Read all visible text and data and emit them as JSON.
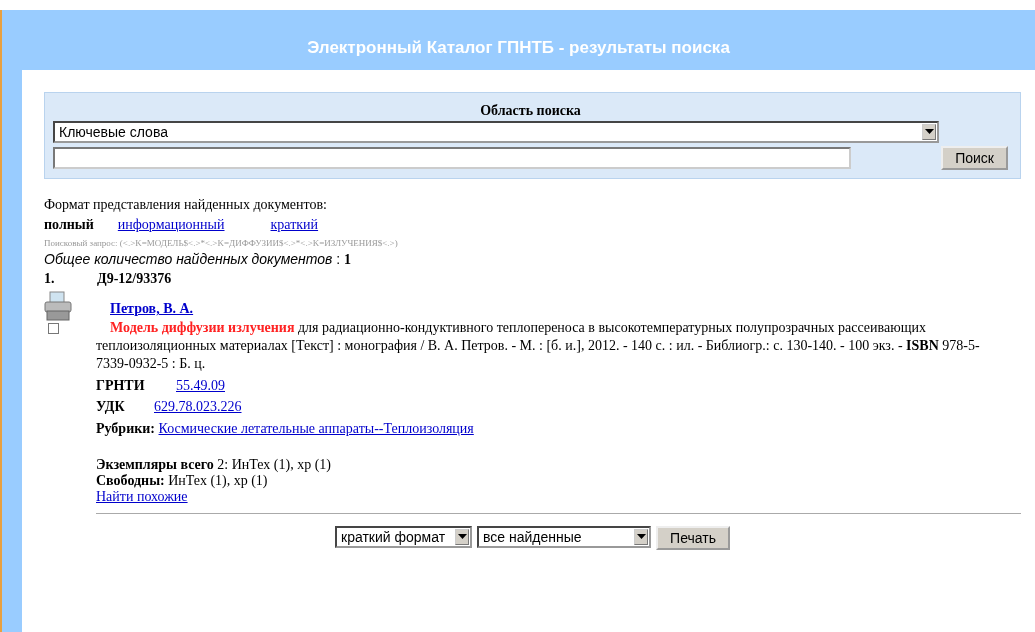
{
  "header": {
    "title": "Электронный Каталог ГПНТБ - результаты поиска"
  },
  "search": {
    "label": "Область поиска",
    "area": "Ключевые слова",
    "button": "Поиск"
  },
  "format": {
    "label": "Формат представления найденных документов:",
    "options": [
      {
        "label": "полный",
        "selected": true
      },
      {
        "label": "информационный",
        "selected": false
      },
      {
        "label": "краткий",
        "selected": false
      }
    ]
  },
  "query_text": "Поисковый запрос: (<.>K=МОДЕЛЬ$<.>*<.>K=ДИФФУЗИИ$<.>*<.>K=ИЗЛУЧЕНИЯ$<.>)",
  "total": {
    "label": "Общее количество найденных документов",
    "separator": ":",
    "value": "1"
  },
  "results": [
    {
      "number": "1.",
      "code": "Д9-12/93376",
      "checked": false,
      "author": "Петров, В. А.",
      "title": "Модель диффузии излучения",
      "description": "для радиационно-кондуктивного теплопереноса в высокотемпературных полупрозрачных рассеивающих теплоизоляционных материалах [Текст] : монография / В. А. Петров. - М. : [б. и.], 2012. - 140 с. : ил. - Библиогр.: с. 130-140. - 100 экз. - **ISBN** 978-5-7339-0932-5 : Б. ц.",
      "grnti_label": "ГРНТИ",
      "grnti": "55.49.09",
      "udk_label": "УДК",
      "udk": "629.78.023.226",
      "rubrics_label": "Рубрики:",
      "rubric": "Космические летательные аппараты--Теплоизоляция",
      "copies_label": "Экземпляры всего",
      "copies": "2: ИнТех (1), хр (1)",
      "free_label": "Свободны:",
      "free": "ИнТех (1), хр (1)",
      "similar": "Найти похожие"
    }
  ],
  "print": {
    "format": "краткий формат",
    "scope": "все найденные",
    "button": "Печать"
  }
}
